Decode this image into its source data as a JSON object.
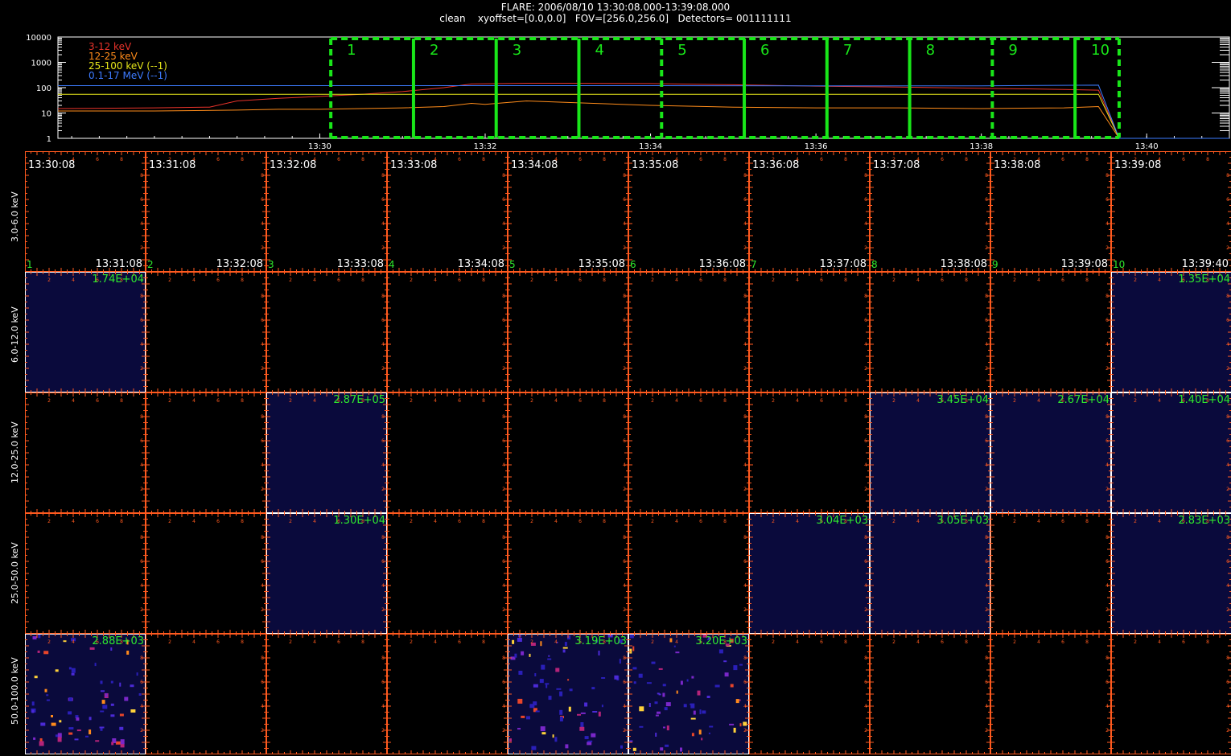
{
  "header": {
    "line1": "FLARE: 2006/08/10 13:30:08.000-13:39:08.000",
    "line2": "clean    xyoffset=[0.0,0.0]   FOV=[256.0,256.0]   Detectors= 001111111"
  },
  "colors": {
    "frame": "#ff5a1f",
    "interval_green": "#19e619",
    "label_green": "#2ee82e",
    "image_bg": "#0a0a3c"
  },
  "chart_data": {
    "type": "line",
    "yscale": "log",
    "ylim": [
      1,
      10000
    ],
    "yticks": [
      "10000",
      "1000",
      "100",
      "10",
      "1"
    ],
    "xrange": [
      "13:26:50",
      "13:41:00"
    ],
    "xtick_labels": [
      "13:30",
      "13:32",
      "13:34",
      "13:36",
      "13:38",
      "13:40"
    ],
    "series": [
      {
        "name": "3-12 keV",
        "color": "#e8332a",
        "x": [
          "13:26:50",
          "13:28:00",
          "13:28:40",
          "13:29:00",
          "13:29:30",
          "13:30:00",
          "13:30:30",
          "13:31:00",
          "13:31:30",
          "13:31:50",
          "13:32:30",
          "13:33:00",
          "13:34:00",
          "13:35:00",
          "13:36:00",
          "13:37:00",
          "13:38:00",
          "13:39:00",
          "13:39:25",
          "13:39:40"
        ],
        "values": [
          15,
          16,
          17,
          30,
          38,
          45,
          55,
          70,
          100,
          140,
          150,
          150,
          145,
          130,
          115,
          105,
          95,
          85,
          80,
          1
        ]
      },
      {
        "name": "12-25 keV",
        "color": "#ff8c1a",
        "x": [
          "13:26:50",
          "13:28:00",
          "13:29:00",
          "13:29:30",
          "13:30:00",
          "13:30:30",
          "13:31:00",
          "13:31:30",
          "13:31:50",
          "13:32:00",
          "13:32:30",
          "13:33:00",
          "13:34:00",
          "13:35:00",
          "13:36:00",
          "13:37:00",
          "13:38:00",
          "13:39:00",
          "13:39:25",
          "13:39:40"
        ],
        "values": [
          12,
          12,
          13,
          14,
          14,
          15,
          16,
          18,
          24,
          22,
          30,
          26,
          20,
          17,
          16,
          16,
          15,
          16,
          18,
          1
        ]
      },
      {
        "name": "25-100 keV (--1)",
        "color": "#e6e61a",
        "x": [
          "13:26:50",
          "13:30:00",
          "13:32:00",
          "13:34:00",
          "13:36:00",
          "13:38:00",
          "13:39:25",
          "13:39:40"
        ],
        "values": [
          55,
          55,
          55,
          55,
          55,
          55,
          55,
          1
        ]
      },
      {
        "name": "0.1-17 MeV (--1)",
        "color": "#3d7bff",
        "x": [
          "13:26:50",
          "13:30:00",
          "13:32:00",
          "13:34:00",
          "13:36:00",
          "13:38:00",
          "13:39:25",
          "13:39:40",
          "13:41:00"
        ],
        "values": [
          120,
          120,
          120,
          120,
          118,
          118,
          125,
          1,
          1
        ]
      }
    ],
    "intervals": {
      "labels": [
        "1",
        "2",
        "3",
        "4",
        "5",
        "6",
        "7",
        "8",
        "9",
        "10"
      ],
      "boundaries": [
        "13:30:08",
        "13:31:08",
        "13:32:08",
        "13:33:08",
        "13:34:08",
        "13:35:08",
        "13:36:08",
        "13:37:08",
        "13:38:08",
        "13:39:08",
        "13:39:40"
      ]
    }
  },
  "image_grid": {
    "columns": [
      {
        "index": "1",
        "start": "13:30:08",
        "end": "13:31:08"
      },
      {
        "index": "2",
        "start": "13:31:08",
        "end": "13:32:08"
      },
      {
        "index": "3",
        "start": "13:32:08",
        "end": "13:33:08"
      },
      {
        "index": "4",
        "start": "13:33:08",
        "end": "13:34:08"
      },
      {
        "index": "5",
        "start": "13:34:08",
        "end": "13:35:08"
      },
      {
        "index": "6",
        "start": "13:35:08",
        "end": "13:36:08"
      },
      {
        "index": "7",
        "start": "13:36:08",
        "end": "13:37:08"
      },
      {
        "index": "8",
        "start": "13:37:08",
        "end": "13:38:08"
      },
      {
        "index": "9",
        "start": "13:38:08",
        "end": "13:39:08"
      },
      {
        "index": "10",
        "start": "13:39:08",
        "end": "13:39:40"
      }
    ],
    "rows": [
      {
        "label": "3.0-6.0 keV",
        "cells": [
          null,
          null,
          null,
          null,
          null,
          null,
          null,
          null,
          null,
          null
        ]
      },
      {
        "label": "6.0-12.0 keV",
        "cells": [
          "1.74E+04",
          null,
          null,
          null,
          null,
          null,
          null,
          null,
          null,
          "1.35E+04"
        ]
      },
      {
        "label": "12.0-25.0 keV",
        "cells": [
          null,
          null,
          "2.87E+05",
          null,
          null,
          null,
          null,
          "3.45E+04",
          "2.67E+04",
          "1.40E+04"
        ]
      },
      {
        "label": "25.0-50.0 keV",
        "cells": [
          null,
          null,
          "1.30E+04",
          null,
          null,
          null,
          "3.04E+03",
          "3.05E+03",
          null,
          "2.83E+03"
        ]
      },
      {
        "label": "50.0-100.0 keV",
        "cells": [
          "2.88E+03",
          null,
          null,
          null,
          "3.19E+03",
          "3.20E+03",
          null,
          null,
          null,
          null
        ]
      }
    ],
    "axis_ticks": [
      "2",
      "4",
      "6",
      "8"
    ],
    "speckled_cells": [
      [
        4,
        0
      ],
      [
        4,
        4
      ],
      [
        4,
        5
      ]
    ]
  }
}
